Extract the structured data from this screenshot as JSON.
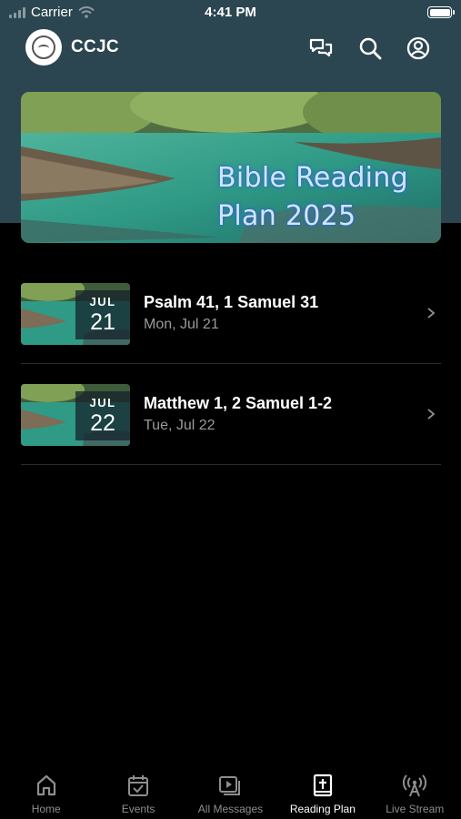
{
  "status_bar": {
    "carrier": "Carrier",
    "time": "4:41 PM"
  },
  "header": {
    "title": "CCJC"
  },
  "banner": {
    "title_line1": "Bible Reading",
    "title_line2": "Plan 2025"
  },
  "readings": [
    {
      "month": "JUL",
      "day": "21",
      "title": "Psalm 41, 1 Samuel 31",
      "date": "Mon, Jul 21"
    },
    {
      "month": "JUL",
      "day": "22",
      "title": "Matthew 1, 2 Samuel 1-2",
      "date": "Tue, Jul 22"
    }
  ],
  "tabs": [
    {
      "label": "Home",
      "icon": "home-icon",
      "active": false
    },
    {
      "label": "Events",
      "icon": "calendar-icon",
      "active": false
    },
    {
      "label": "All Messages",
      "icon": "video-icon",
      "active": false
    },
    {
      "label": "Reading Plan",
      "icon": "bible-icon",
      "active": true
    },
    {
      "label": "Live Stream",
      "icon": "broadcast-icon",
      "active": false
    }
  ],
  "colors": {
    "header_bg": "#2c4651",
    "background": "#000000",
    "active_tab": "#ffffff",
    "inactive_tab": "#8e8e8e"
  }
}
